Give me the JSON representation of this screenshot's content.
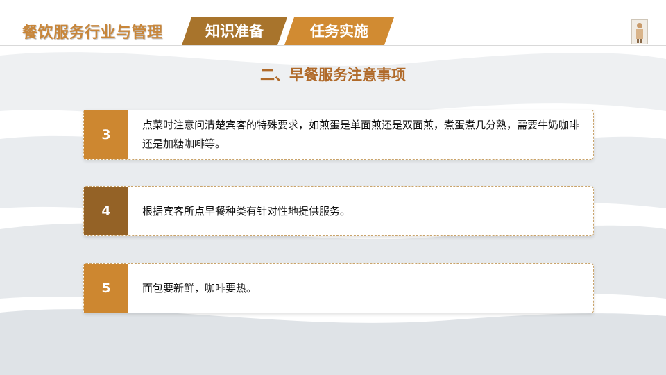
{
  "header": {
    "brand": "餐饮服务行业与管理",
    "tabs": [
      {
        "label": "知识准备"
      },
      {
        "label": "任务实施"
      }
    ]
  },
  "section_title": "二、早餐服务注意事项",
  "items": [
    {
      "number": "3",
      "text": "点菜时注意问清楚宾客的特殊要求，如煎蛋是单面煎还是双面煎，煮蛋煮几分熟，需要牛奶咖啡还是加糖咖啡等。"
    },
    {
      "number": "4",
      "text": "根据宾客所点早餐种类有针对性地提供服务。"
    },
    {
      "number": "5",
      "text": "面包要新鲜，咖啡要热。"
    }
  ],
  "colors": {
    "accent_light": "#cd8730",
    "accent_dark": "#946226",
    "title": "#b06a2a"
  }
}
